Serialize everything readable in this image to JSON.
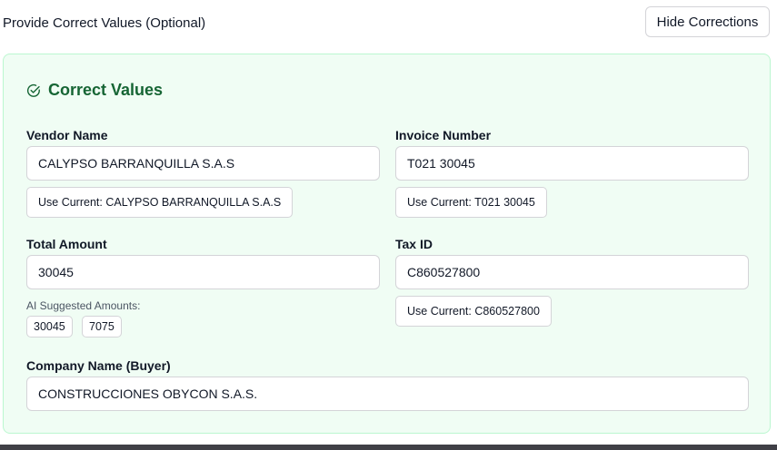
{
  "header": {
    "title": "Provide Correct Values (Optional)",
    "hide_button_label": "Hide Corrections"
  },
  "panel": {
    "title": "Correct Values",
    "icon": "circle-check-icon",
    "accent_color": "#166534",
    "background_color": "#f0fdf4"
  },
  "fields": {
    "vendor_name": {
      "label": "Vendor Name",
      "value": "CALYPSO BARRANQUILLA S.A.S",
      "use_current": "Use Current: CALYPSO BARRANQUILLA S.A.S"
    },
    "invoice_number": {
      "label": "Invoice Number",
      "value": "T021 30045",
      "use_current": "Use Current: T021 30045"
    },
    "total_amount": {
      "label": "Total Amount",
      "value": "30045",
      "ai_suggested_label": "AI Suggested Amounts:",
      "ai_suggestions": [
        "30045",
        "7075"
      ]
    },
    "tax_id": {
      "label": "Tax ID",
      "value": "C860527800",
      "use_current": "Use Current: C860527800"
    },
    "company_name": {
      "label": "Company Name (Buyer)",
      "value": "CONSTRUCCIONES OBYCON S.A.S."
    }
  }
}
